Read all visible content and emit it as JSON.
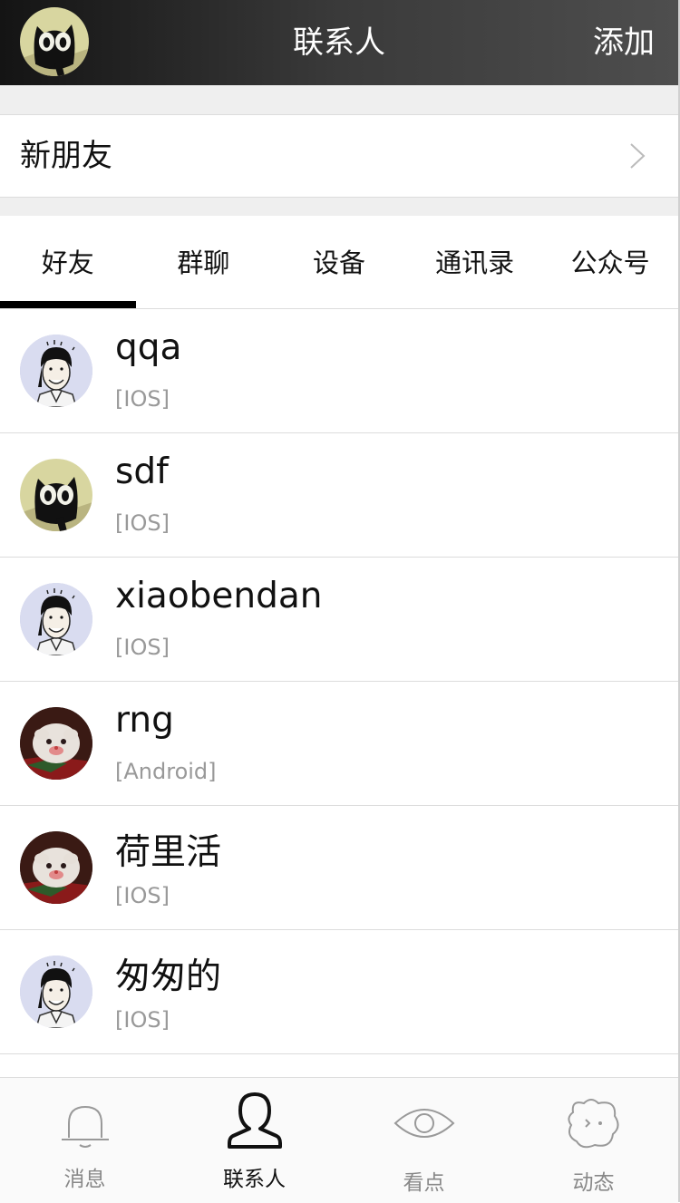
{
  "header": {
    "title": "联系人",
    "add_label": "添加",
    "avatar": "cat-avatar"
  },
  "new_friends": {
    "label": "新朋友",
    "icon": "chevron-right-icon"
  },
  "tabs": [
    {
      "label": "好友",
      "active": true
    },
    {
      "label": "群聊",
      "active": false
    },
    {
      "label": "设备",
      "active": false
    },
    {
      "label": "通讯录",
      "active": false
    },
    {
      "label": "公众号",
      "active": false
    }
  ],
  "contacts": [
    {
      "name": "qqa",
      "platform": "[IOS]",
      "avatar": "manga-man-avatar"
    },
    {
      "name": "sdf",
      "platform": "[IOS]",
      "avatar": "cat-avatar"
    },
    {
      "name": "xiaobendan",
      "platform": "[IOS]",
      "avatar": "manga-man-avatar"
    },
    {
      "name": "rng",
      "platform": "[Android]",
      "avatar": "poro-avatar"
    },
    {
      "name": "荷里活",
      "platform": "[IOS]",
      "avatar": "poro-avatar"
    },
    {
      "name": "匆匆的",
      "platform": "[IOS]",
      "avatar": "manga-man-avatar"
    }
  ],
  "bottom_nav": [
    {
      "label": "消息",
      "icon": "bell-icon",
      "active": false
    },
    {
      "label": "联系人",
      "icon": "person-icon",
      "active": true
    },
    {
      "label": "看点",
      "icon": "eye-icon",
      "active": false
    },
    {
      "label": "动态",
      "icon": "star-face-icon",
      "active": false
    }
  ],
  "colors": {
    "header_start": "#141414",
    "header_end": "#4e4e4e",
    "active": "#000000",
    "muted": "#999999",
    "nav_inactive": "#888888"
  }
}
